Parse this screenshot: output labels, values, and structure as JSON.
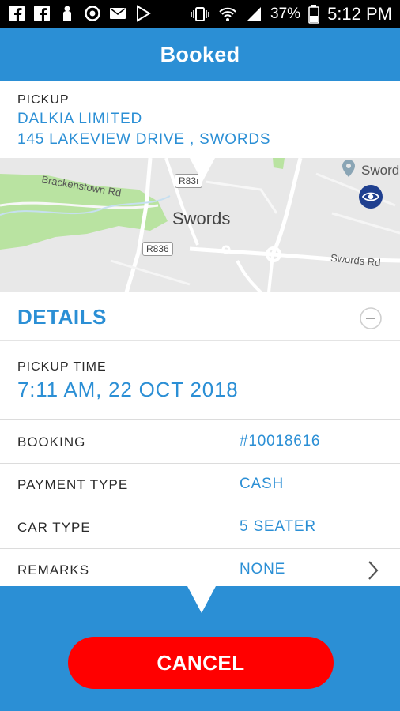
{
  "status_bar": {
    "battery": "37%",
    "time": "5:12 PM",
    "left_icons": [
      "facebook-icon",
      "facebook-icon",
      "person-icon",
      "sync-icon",
      "mail-icon",
      "play-icon"
    ],
    "right_icons": [
      "vibrate-icon",
      "wifi-icon",
      "signal-icon",
      "battery-icon"
    ]
  },
  "header": {
    "title": "Booked"
  },
  "pickup": {
    "label": "PICKUP",
    "name": "DALKIA LIMITED",
    "address": "145 LAKEVIEW DRIVE , SWORDS"
  },
  "map": {
    "town": "Swords",
    "town_top_right": "Sword",
    "road_brackenstown": "Brackenstown Rd",
    "road_swords": "Swords Rd",
    "tag_r836": "R836",
    "tag_r83": "R83ı",
    "eye_button_icon": "eye-icon"
  },
  "details": {
    "title": "DETAILS",
    "collapse_icon": "minus-circle-icon",
    "pickup_time_label": "PICKUP TIME",
    "pickup_time_value": "7:11 AM, 22 OCT 2018",
    "rows": [
      {
        "label": "BOOKING",
        "value": "#10018616"
      },
      {
        "label": "PAYMENT TYPE",
        "value": "CASH"
      },
      {
        "label": "CAR TYPE",
        "value": "5 SEATER"
      },
      {
        "label": "REMARKS",
        "value": "NONE"
      }
    ]
  },
  "actions": {
    "cancel_label": "CANCEL"
  },
  "colors": {
    "primary": "#2b8fd5",
    "cancel": "#ff0000",
    "map_green": "#b9e3a1",
    "eye_button": "#1f3f8f"
  }
}
